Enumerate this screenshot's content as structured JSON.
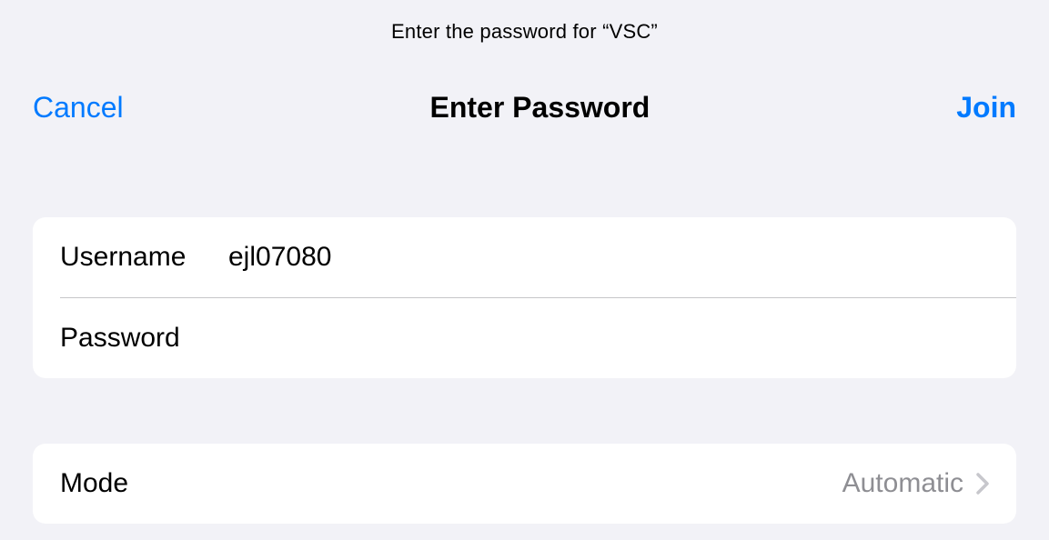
{
  "prompt": "Enter the password for “VSC”",
  "header": {
    "cancel_label": "Cancel",
    "title": "Enter Password",
    "join_label": "Join"
  },
  "credentials": {
    "username_label": "Username",
    "username_value": "ejl07080",
    "password_label": "Password",
    "password_value": ""
  },
  "mode": {
    "label": "Mode",
    "value": "Automatic"
  }
}
